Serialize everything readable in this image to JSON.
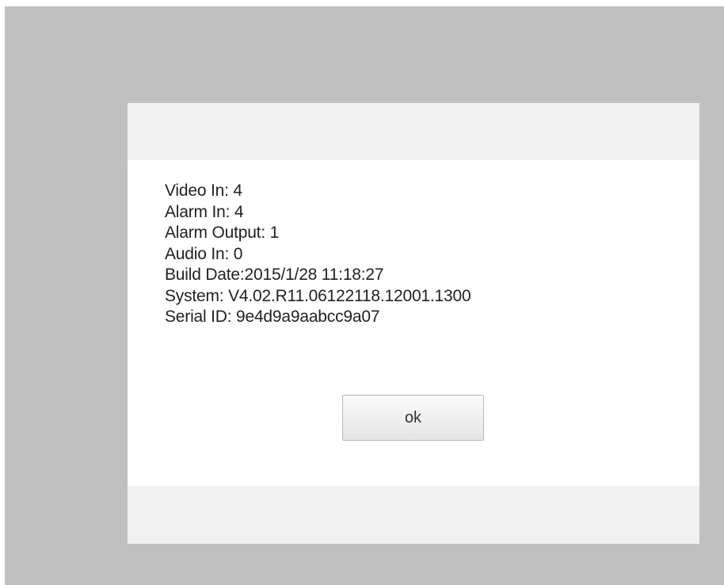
{
  "dialog": {
    "info_lines": [
      "Video In: 4",
      "Alarm In: 4",
      "Alarm Output: 1",
      "Audio In: 0",
      "Build Date:2015/1/28 11:18:27",
      "System: V4.02.R11.06122118.12001.1300",
      "Serial ID: 9e4d9a9aabcc9a07"
    ],
    "ok_label": "ok"
  }
}
